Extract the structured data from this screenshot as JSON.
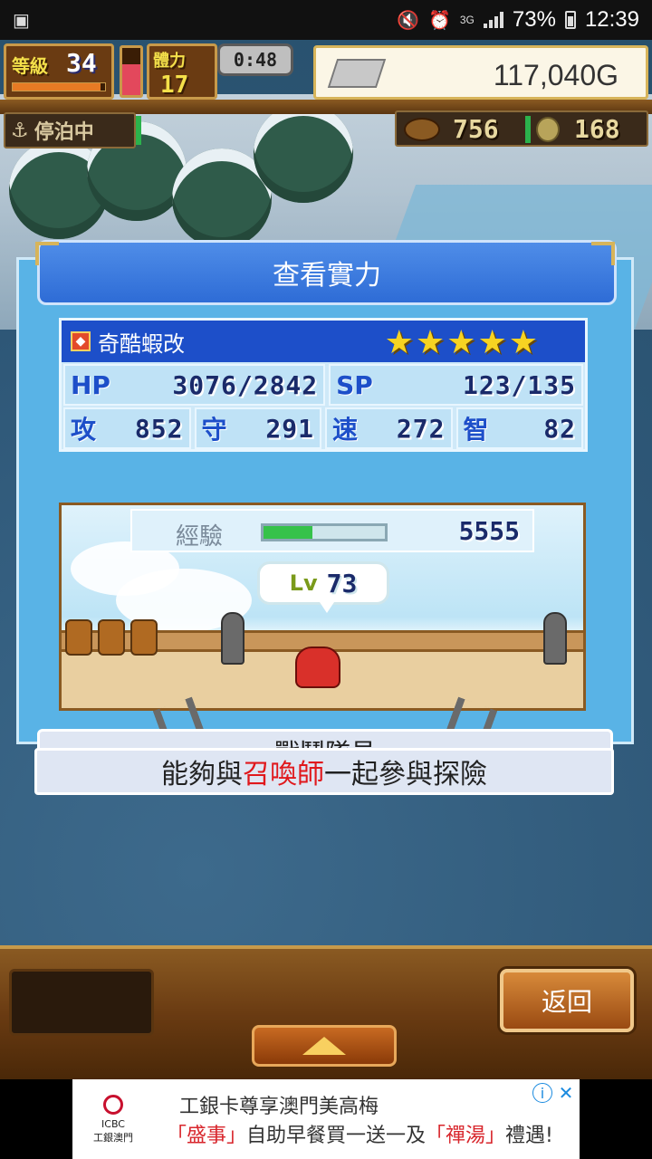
{
  "status_bar": {
    "network": "3G",
    "battery": "73%",
    "time": "12:39"
  },
  "hud": {
    "level_label": "等級",
    "level": "34",
    "level_progress": 0.95,
    "stamina_label": "體力",
    "stamina": "17",
    "stamina_gauge": 0.65,
    "timer": "0:48",
    "gold": "117,040G",
    "status_label": "停泊中",
    "resource_1": "756",
    "resource_2": "168"
  },
  "dialog": {
    "title": "查看實力",
    "name": "奇酷蝦改",
    "stars": "★★★★★",
    "rating": 5,
    "hp_label": "HP",
    "hp": "3076/2842",
    "sp_label": "SP",
    "sp": "123/135",
    "atk_label": "攻",
    "atk": "852",
    "def_label": "守",
    "def": "291",
    "spd_label": "速",
    "spd": "272",
    "int_label": "智",
    "int": "82",
    "exp_label": "經驗",
    "exp": "5555",
    "exp_progress": 0.4,
    "lv_label": "Lv",
    "lv": "73",
    "role": "戰鬥隊員",
    "desc_pre": "能夠與",
    "desc_highlight": "召喚師",
    "desc_post": "一起參與探險"
  },
  "bottom_bar": {
    "back_label": "返回"
  },
  "ad": {
    "logo_text": "ICBC\n工銀澳門",
    "line1": "工銀卡尊享澳門美高梅",
    "line2_a": "「盛事」",
    "line2_b": "自助早餐買一送一及",
    "line2_c": "「禪湯」",
    "line2_d": "禮遇!"
  }
}
